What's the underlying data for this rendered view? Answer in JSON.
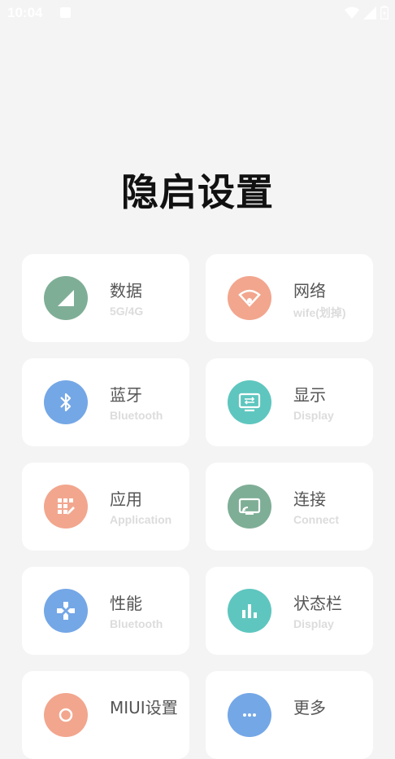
{
  "status_bar": {
    "time": "10:04"
  },
  "page": {
    "title": "隐启设置"
  },
  "cards": [
    {
      "label": "数据",
      "sub": "5G/4G",
      "icon": "signal-icon",
      "color": "#7fae96"
    },
    {
      "label": "网络",
      "sub": "wife(划掉)",
      "icon": "wifi-icon",
      "color": "#f2a68e"
    },
    {
      "label": "蓝牙",
      "sub": "Bluetooth",
      "icon": "bluetooth-icon",
      "color": "#74a7e6"
    },
    {
      "label": "显示",
      "sub": "Display",
      "icon": "display-icon",
      "color": "#5ec6bf"
    },
    {
      "label": "应用",
      "sub": "Application",
      "icon": "app-grid-icon",
      "color": "#f2a68e"
    },
    {
      "label": "连接",
      "sub": "Connect",
      "icon": "cast-icon",
      "color": "#7fae96"
    },
    {
      "label": "性能",
      "sub": "Bluetooth",
      "icon": "gamepad-icon",
      "color": "#74a7e6"
    },
    {
      "label": "状态栏",
      "sub": "Display",
      "icon": "bar-chart-icon",
      "color": "#5ec6bf"
    },
    {
      "label": "MIUI设置",
      "sub": "",
      "icon": "settings-icon",
      "color": "#f2a68e"
    },
    {
      "label": "更多",
      "sub": "",
      "icon": "more-icon",
      "color": "#74a7e6"
    }
  ]
}
